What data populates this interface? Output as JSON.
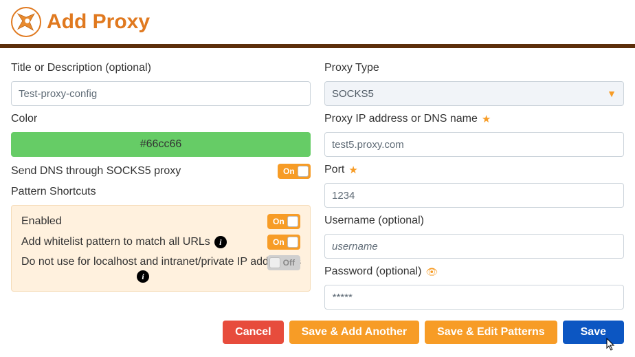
{
  "header": {
    "title": "Add Proxy"
  },
  "left": {
    "title_label": "Title or Description (optional)",
    "title_value": "Test-proxy-config",
    "color_label": "Color",
    "color_value": "#66cc66",
    "dns_label": "Send DNS through SOCKS5 proxy",
    "dns_on": "On",
    "shortcuts_label": "Pattern Shortcuts",
    "shortcuts": {
      "enabled_label": "Enabled",
      "enabled_on": "On",
      "whitelist_label": "Add whitelist pattern to match all URLs",
      "whitelist_on": "On",
      "localhost_label": "Do not use for localhost and intranet/private IP addresses",
      "localhost_off": "Off"
    }
  },
  "right": {
    "proxy_type_label": "Proxy Type",
    "proxy_type_value": "SOCKS5",
    "ip_label": "Proxy IP address or DNS name",
    "ip_value": "test5.proxy.com",
    "port_label": "Port",
    "port_value": "1234",
    "user_label": "Username (optional)",
    "user_placeholder": "username",
    "pass_label": "Password (optional)",
    "pass_placeholder": "*****"
  },
  "buttons": {
    "cancel": "Cancel",
    "save_add": "Save & Add Another",
    "save_edit": "Save & Edit Patterns",
    "save": "Save"
  }
}
